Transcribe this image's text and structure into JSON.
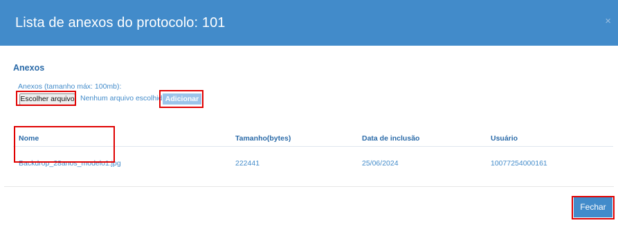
{
  "modal": {
    "title": "Lista de anexos do protocolo: 101",
    "close_icon": "×"
  },
  "attachments": {
    "section_title": "Anexos",
    "field_label": "Anexos (tamanho máx: 100mb):",
    "choose_file_label": "Escolher arquivo",
    "no_file_text": "Nenhum arquivo escolhido",
    "add_label": "Adicionar"
  },
  "table": {
    "headers": [
      "Nome",
      "Tamanho(bytes)",
      "Data de inclusão",
      "Usuário"
    ],
    "rows": [
      [
        "Backdrop_28anos_modelo1.jpg",
        "222441",
        "25/06/2024",
        "10077254000161"
      ]
    ]
  },
  "footer": {
    "close_label": "Fechar"
  },
  "colors": {
    "header_bg": "#428bca",
    "accent": "#428bca",
    "highlight": "#e00000"
  }
}
